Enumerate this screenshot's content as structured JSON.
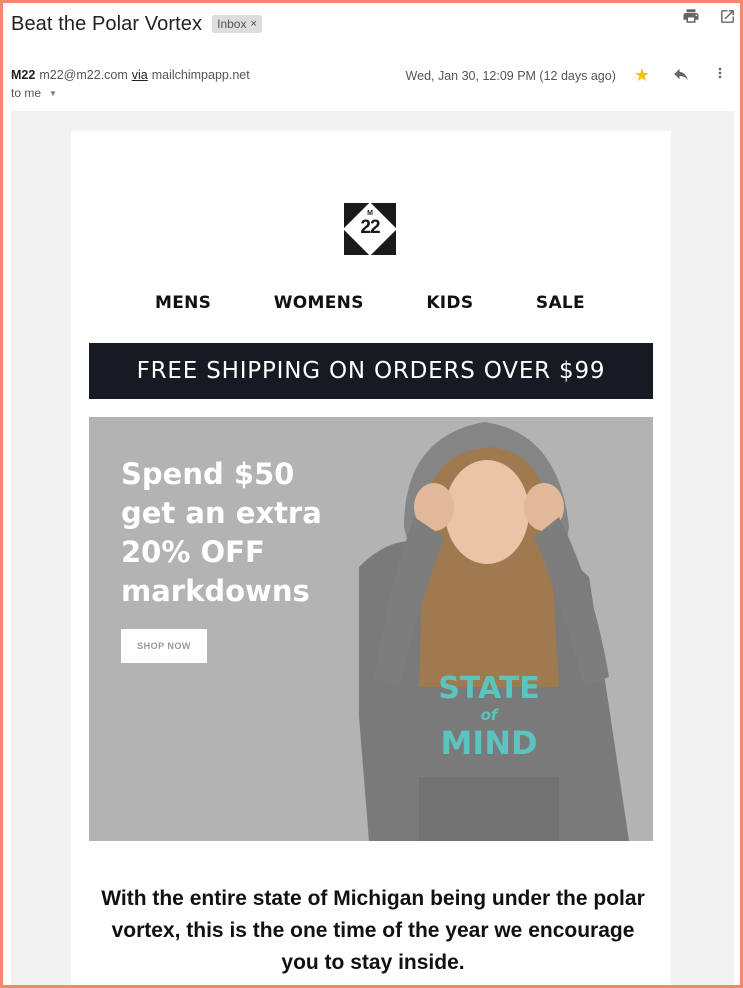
{
  "email": {
    "subject": "Beat the Polar Vortex",
    "label": "Inbox",
    "label_close": "×",
    "sender_name": "M22",
    "sender_email": "m22@m22.com",
    "via": "via",
    "via_domain": "mailchimpapp.net",
    "date": "Wed, Jan 30, 12:09 PM (12 days ago)",
    "to": "to me",
    "icons": [
      "print-icon",
      "open-in-new-icon",
      "star-icon",
      "reply-icon",
      "more-vert-icon"
    ]
  },
  "newsletter": {
    "logo_top": "M",
    "logo_number": "22",
    "nav": [
      "MENS",
      "WOMENS",
      "KIDS",
      "SALE"
    ],
    "banner": "FREE SHIPPING ON ORDERS OVER $99",
    "hero_lines": [
      "Spend $50",
      "get an extra",
      "20% OFF",
      "markdowns"
    ],
    "shop_button": "SHOP NOW",
    "hoodie_text": [
      "STATE",
      "of",
      "MIND"
    ],
    "body_text": "With the entire state of Michigan being under the polar vortex, this is the one time of the year we encourage you to stay inside."
  },
  "colors": {
    "frame_border": "#ef8a6b",
    "banner_bg": "#161a22",
    "star": "#f4c20d",
    "hoodie_print": "#5cc3c0"
  }
}
